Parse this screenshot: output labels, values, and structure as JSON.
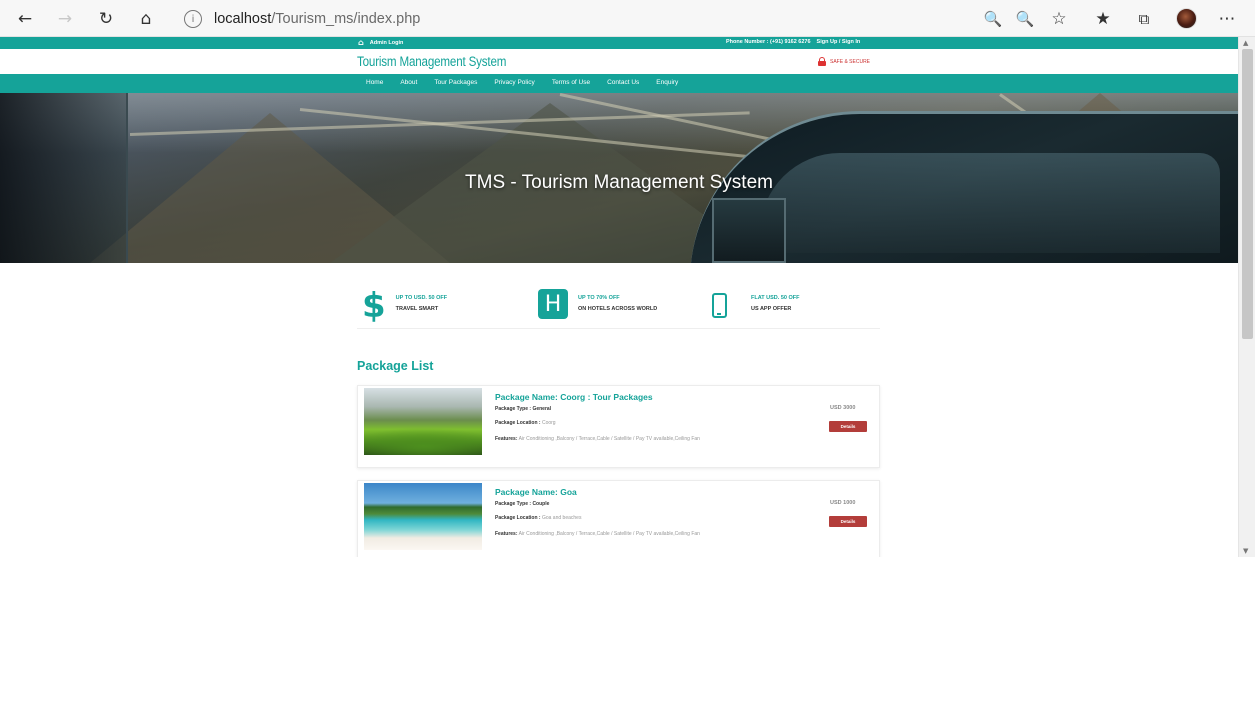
{
  "browser": {
    "url_host": "localhost",
    "url_path": "/Tourism_ms/index.php",
    "icons": [
      "back-icon",
      "forward-icon",
      "refresh-icon",
      "home-icon",
      "info-icon",
      "zoom-in-icon",
      "zoom-out-icon",
      "favorite-icon",
      "favorites-list-icon",
      "collections-icon",
      "profile-avatar",
      "more-icon"
    ]
  },
  "topbar": {
    "admin_login": "Admin Login",
    "phone": "Phone Number : (+91) 9162 6276",
    "signup_signin": "Sign Up / Sign In"
  },
  "header": {
    "logo": "Tourism Management System",
    "secure_text": "SAFE & SECURE"
  },
  "nav": {
    "items": [
      {
        "label": "Home"
      },
      {
        "label": "About"
      },
      {
        "label": "Tour Packages"
      },
      {
        "label": "Privacy Policy"
      },
      {
        "label": "Terms of Use"
      },
      {
        "label": "Contact Us"
      },
      {
        "label": "Enquiry"
      }
    ]
  },
  "hero": {
    "title": "TMS - Tourism Management System"
  },
  "offers": [
    {
      "icon": "dollar-icon",
      "top": "UP TO USD. 50 OFF",
      "bottom": "TRAVEL SMART"
    },
    {
      "icon": "hotel-icon",
      "top": "UP TO 70% OFF",
      "bottom": "ON HOTELS ACROSS WORLD"
    },
    {
      "icon": "phone-icon",
      "top": "FLAT USD. 50 OFF",
      "bottom": "US APP OFFER"
    }
  ],
  "packages": {
    "heading": "Package List",
    "items": [
      {
        "name": "Package Name: Coorg : Tour Packages",
        "type_label": "Package Type :",
        "type": "General",
        "location_label": "Package Location :",
        "location": "Coorg",
        "features_label": "Features:",
        "features": "Air Conditioning ,Balcony / Terrace,Cable / Satellite / Pay TV available,Ceiling Fan",
        "price": "USD 3000",
        "button": "Details"
      },
      {
        "name": "Package Name: Goa",
        "type_label": "Package Type :",
        "type": "Couple",
        "location_label": "Package Location :",
        "location": "Goa and beaches",
        "features_label": "Features:",
        "features": "Air Conditioning ,Balcony / Terrace,Cable / Satellite / Pay TV available,Ceiling Fan",
        "price": "USD 1000",
        "button": "Details"
      }
    ]
  }
}
